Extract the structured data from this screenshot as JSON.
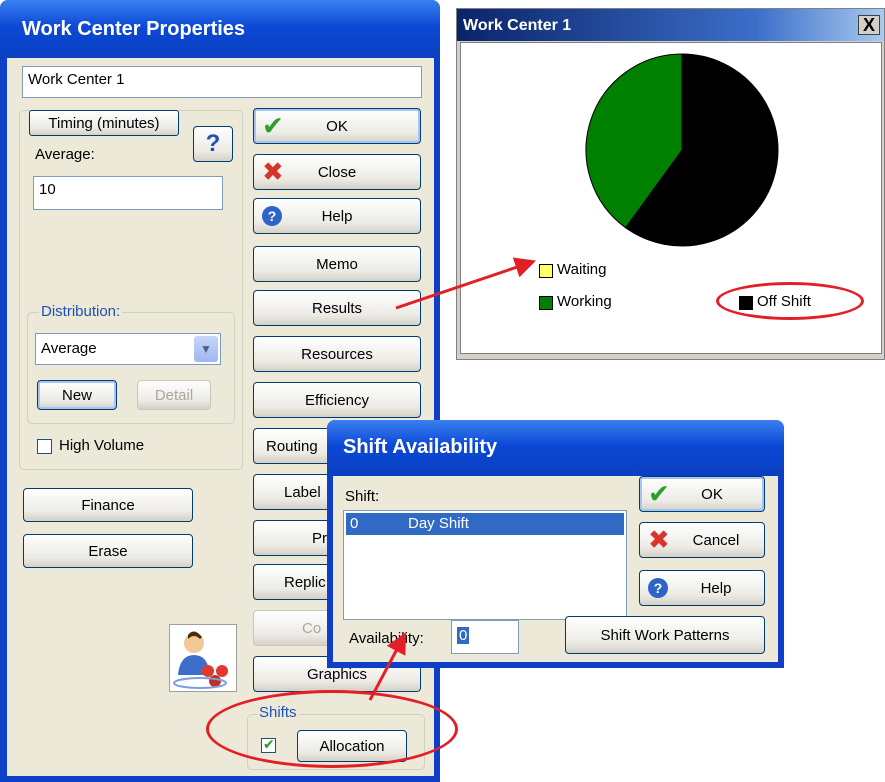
{
  "work_center_properties": {
    "title": "Work Center Properties",
    "name_value": "Work Center 1",
    "timing_button": "Timing (minutes)",
    "help_icon_glyph": "?",
    "average_label": "Average:",
    "average_value": "10",
    "distribution_label": "Distribution:",
    "distribution_value": "Average",
    "new_button": "New",
    "detail_button": "Detail",
    "high_volume_label": "High Volume",
    "finance_button": "Finance",
    "erase_button": "Erase",
    "ok_button": "OK",
    "close_button": "Close",
    "help_button": "Help",
    "memo_button": "Memo",
    "results_button": "Results",
    "resources_button": "Resources",
    "efficiency_button": "Efficiency",
    "routing_button": "Routing",
    "labels_button": "Label",
    "pr_button": "Pr",
    "replic_button": "Replic",
    "con_button": "Co",
    "graphics_button": "Graphics",
    "shifts_label": "Shifts",
    "allocation_button": "Allocation",
    "allocation_checked": true
  },
  "work_center_chart": {
    "title": "Work Center 1",
    "close_glyph": "X"
  },
  "chart_data": {
    "type": "pie",
    "title": "",
    "categories": [
      "Waiting",
      "Working",
      "Off Shift"
    ],
    "values": [
      0,
      40,
      60
    ],
    "colors": [
      "#ffff66",
      "#008000",
      "#000000"
    ],
    "legend": [
      "Waiting",
      "Working",
      "Off Shift"
    ]
  },
  "shift_availability": {
    "title": "Shift Availability",
    "shift_label": "Shift:",
    "shifts": [
      {
        "id": "0",
        "name": "Day Shift"
      }
    ],
    "availability_label": "Availability:",
    "availability_value": "0",
    "ok_button": "OK",
    "cancel_button": "Cancel",
    "help_button": "Help",
    "patterns_button": "Shift Work Patterns"
  },
  "colors": {
    "xp_title": "#0c49d6",
    "highlight_red": "#e21f26",
    "selection": "#316ac5"
  }
}
